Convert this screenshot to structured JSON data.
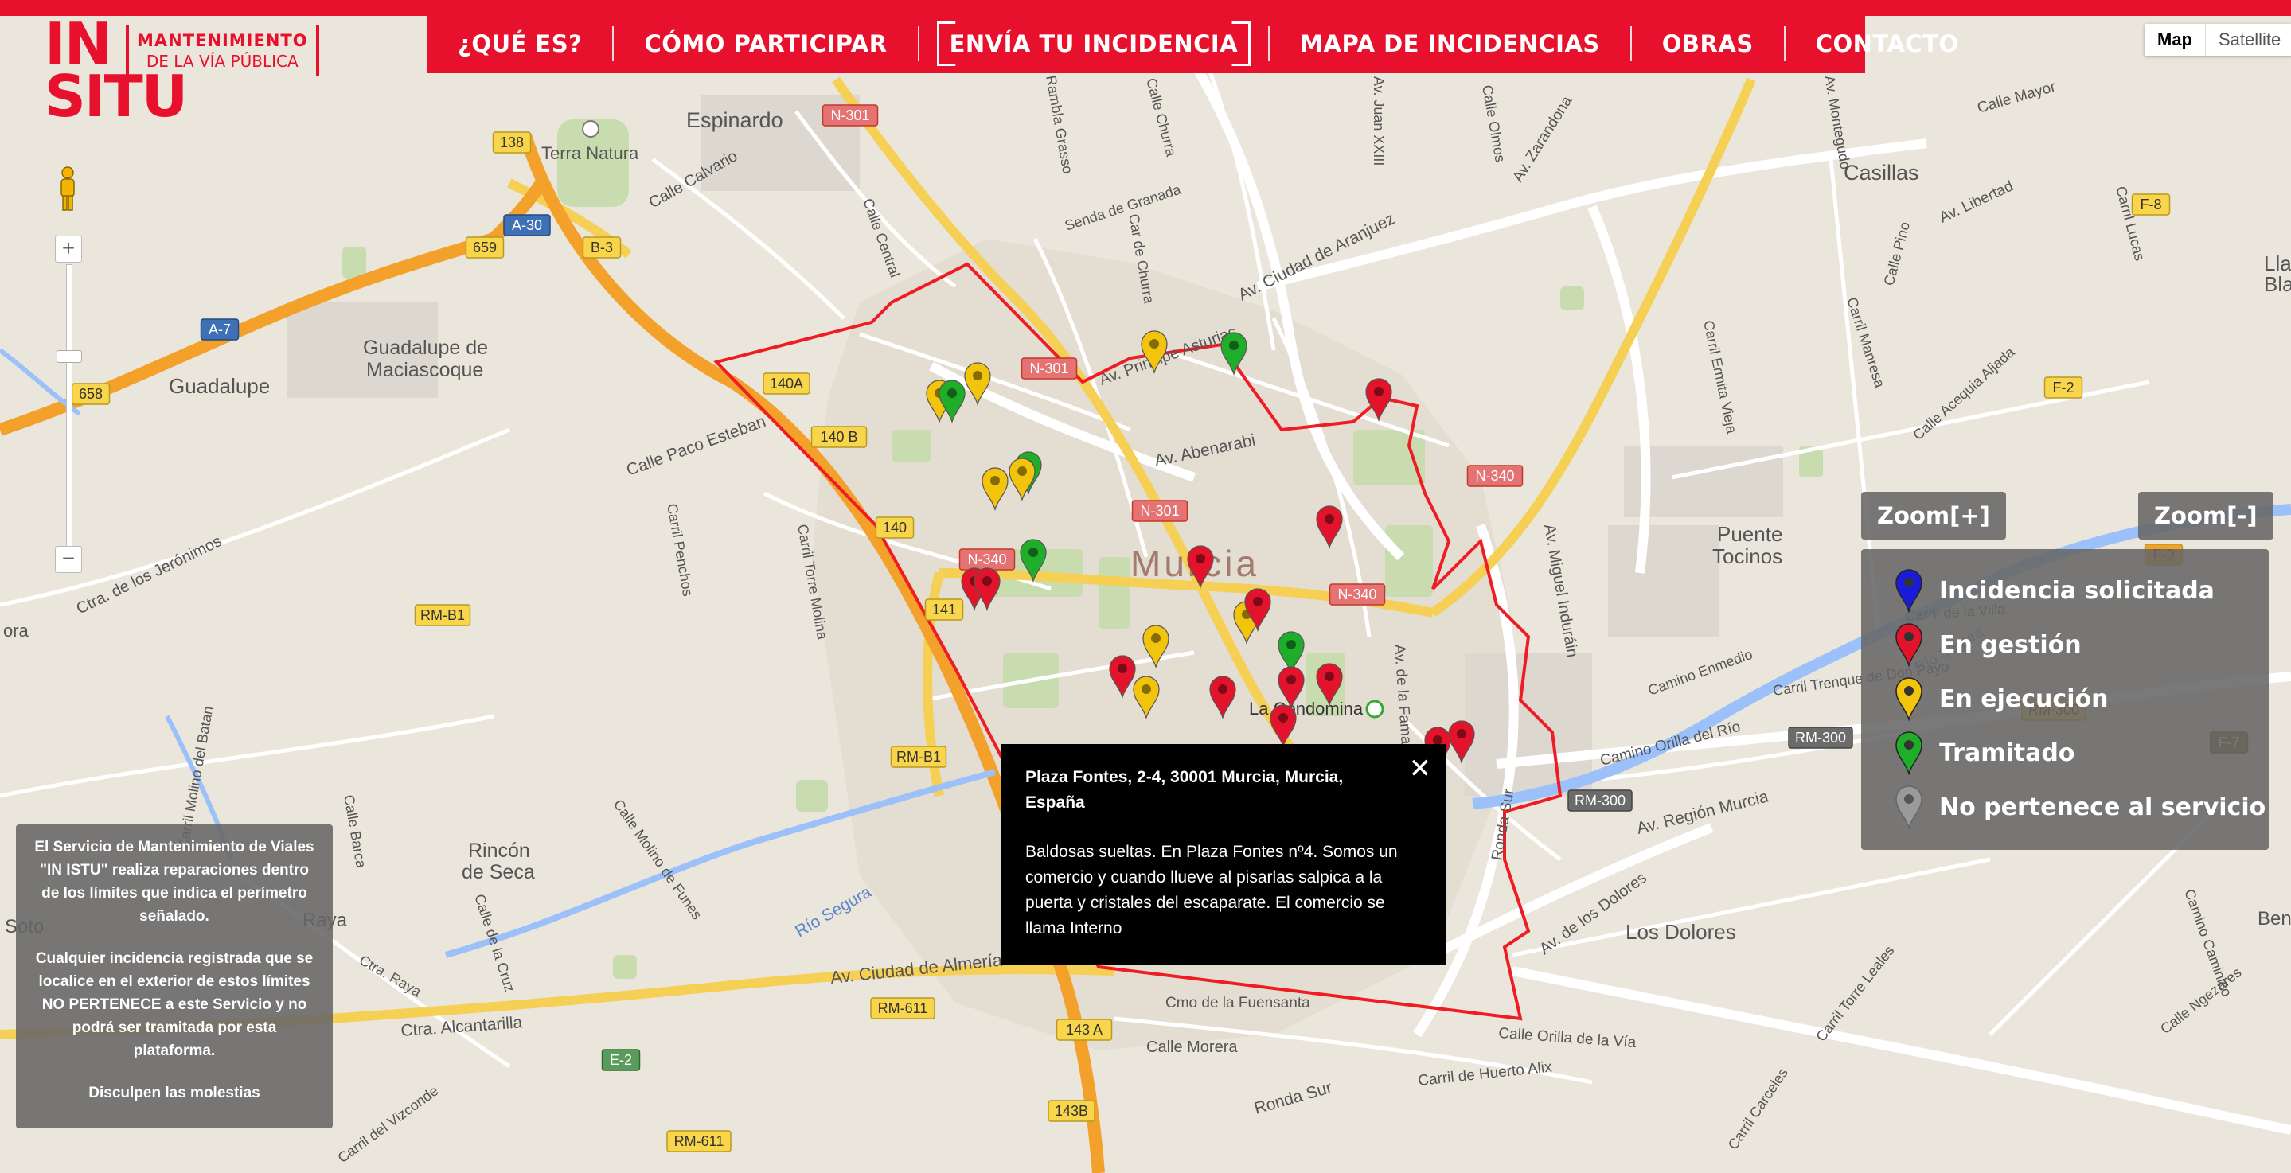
{
  "logo": {
    "top": "IN",
    "bottom": "SITU",
    "sub_line1": "MANTENIMIENTO",
    "sub_line2": "DE LA VÍA PÚBLICA"
  },
  "nav": {
    "items": [
      {
        "label": "¿QUÉ ES?"
      },
      {
        "label": "CÓMO PARTICIPAR"
      },
      {
        "label": "ENVÍA TU INCIDENCIA",
        "active": true
      },
      {
        "label": "MAPA DE INCIDENCIAS"
      },
      {
        "label": "OBRAS"
      },
      {
        "label": "CONTACTO"
      }
    ]
  },
  "map_type": {
    "map": "Map",
    "satellite": "Satellite",
    "selected": "Map"
  },
  "zoom_controls": {
    "zoom_in": "Zoom[+]",
    "zoom_out": "Zoom[-]"
  },
  "legend": [
    {
      "label": "Incidencia solicitada",
      "color": "#1a1adb"
    },
    {
      "label": "En gestión",
      "color": "#e3132b"
    },
    {
      "label": "En ejecución",
      "color": "#f2c40c"
    },
    {
      "label": "Tramitado",
      "color": "#1fae2a"
    },
    {
      "label": "No pertenece al servicio",
      "color": "#9a9a9a"
    }
  ],
  "popup": {
    "title": "Plaza Fontes, 2-4, 30001 Murcia, Murcia, España",
    "body": "Baldosas sueltas. En Plaza Fontes nº4. Somos un comercio y cuando llueve al pisarlas salpica a la puerta y cristales del escaparate. El comercio se llama Interno",
    "close": "✕"
  },
  "notice": {
    "p1": "El Servicio de Mantenimiento de Viales \"IN ISTU\" realiza reparaciones dentro de los límites que indica el perímetro señalado.",
    "p2": "Cualquier incidencia registrada que se localice en el exterior de estos límites NO PERTENECE a este Servicio y no podrá ser tramitada por esta plataforma.",
    "p3": "Disculpen las molestias"
  },
  "map_labels": {
    "places": [
      "Espinardo",
      "Terra Natura",
      "Guadalupe",
      "Guadalupe de",
      "Maciascoque",
      "Casillas",
      "Puente",
      "Tocinos",
      "Murcia",
      "La Condomina",
      "Rincón",
      "de Seca",
      "Los Dolores",
      "Soto",
      "Raya",
      "Beni",
      "Lla",
      "Bla"
    ],
    "streets": [
      "Calle Calvario",
      "Calle Central",
      "Senda de Granada",
      "Av. Ciudad de Aranjuez",
      "Av. Zarandona",
      "Calle Mayor",
      "Av. Libertad",
      "Carril Lucas",
      "Calle Pino",
      "Av. Principe Asturias",
      "Av. Abenarabi",
      "Calle Paco Esteban",
      "Carril Penchos",
      "Carril Torre Molina",
      "Ctra. de los Jerónimos",
      "Av. Miguel Induráin",
      "Carril Ermita Vieja",
      "Carril Manresa",
      "Calle Acequia Aljada",
      "Av. Ciudad de Almería",
      "Ctra. Alcantarilla",
      "Calle Morera",
      "Carril de Huerto Alix",
      "Ronda Sur",
      "Calle Orilla de la Vía",
      "Av. de los Dolores",
      "Av. Región Murcia",
      "Camino Orilla del Río",
      "Camino Enmedio",
      "Carril Trenque de Don Payo",
      "Río Segura",
      "Calle Molino de Funes",
      "Calle de la Cruz",
      "Carril Molino del Batan",
      "Calle Barca",
      "Carril del Vizconde",
      "Carril Carceles",
      "Carril Torre Leales",
      "Calle Ngezares",
      "Camino Caminico",
      "Cmo de la Fuensanta",
      "Av. de la Fama",
      "Calle Olmos",
      "Av. Montegudo",
      "Av. Juan XXIII",
      "Calle Churra",
      "Car de Churra",
      "Rambla Grasso",
      "Carril de la Villa",
      "Ctra. Raya",
      "Calle de la Cruz"
    ],
    "road_badges": [
      "N-301",
      "A-30",
      "B-3",
      "659",
      "138",
      "A-7",
      "658",
      "140A",
      "140 B",
      "140",
      "141",
      "N-340",
      "RM-B1",
      "N-301",
      "N-301",
      "N-340",
      "N-340",
      "F-8",
      "F-2",
      "F-9",
      "RM-300",
      "RM-300",
      "RM-300",
      "F-7",
      "RM-611",
      "E-2",
      "143 A",
      "143B",
      "RM-611",
      "RM-B1"
    ]
  },
  "markers": [
    {
      "color": "yellow",
      "x": 0.23,
      "y": 0.37
    },
    {
      "color": "yellow",
      "x": 0.21,
      "y": 0.41
    }
  ]
}
